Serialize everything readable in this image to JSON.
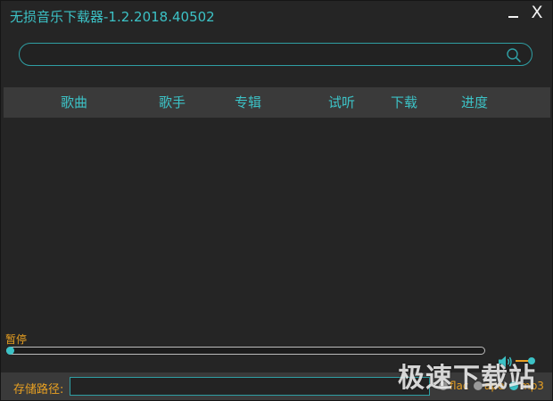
{
  "window": {
    "title": "无损音乐下载器-1.2.2018.40502",
    "close_glyph": "X"
  },
  "search": {
    "value": "",
    "placeholder": "",
    "icon": "search-icon"
  },
  "table": {
    "columns": [
      "歌曲",
      "歌手",
      "专辑",
      "试听",
      "下载",
      "进度"
    ],
    "rows": []
  },
  "player": {
    "status": "暂停",
    "progress": 0,
    "volume_icon": "speaker-icon"
  },
  "footer": {
    "save_path_label": "存储路径:",
    "save_path_value": "",
    "formats": [
      "flac",
      "ape",
      "mp3"
    ],
    "selected_format": "mp3"
  },
  "watermark": "极速下载站",
  "colors": {
    "accent": "#3cc2c6",
    "orange": "#e8a022",
    "background": "#252525",
    "header": "#3a3a3a"
  }
}
